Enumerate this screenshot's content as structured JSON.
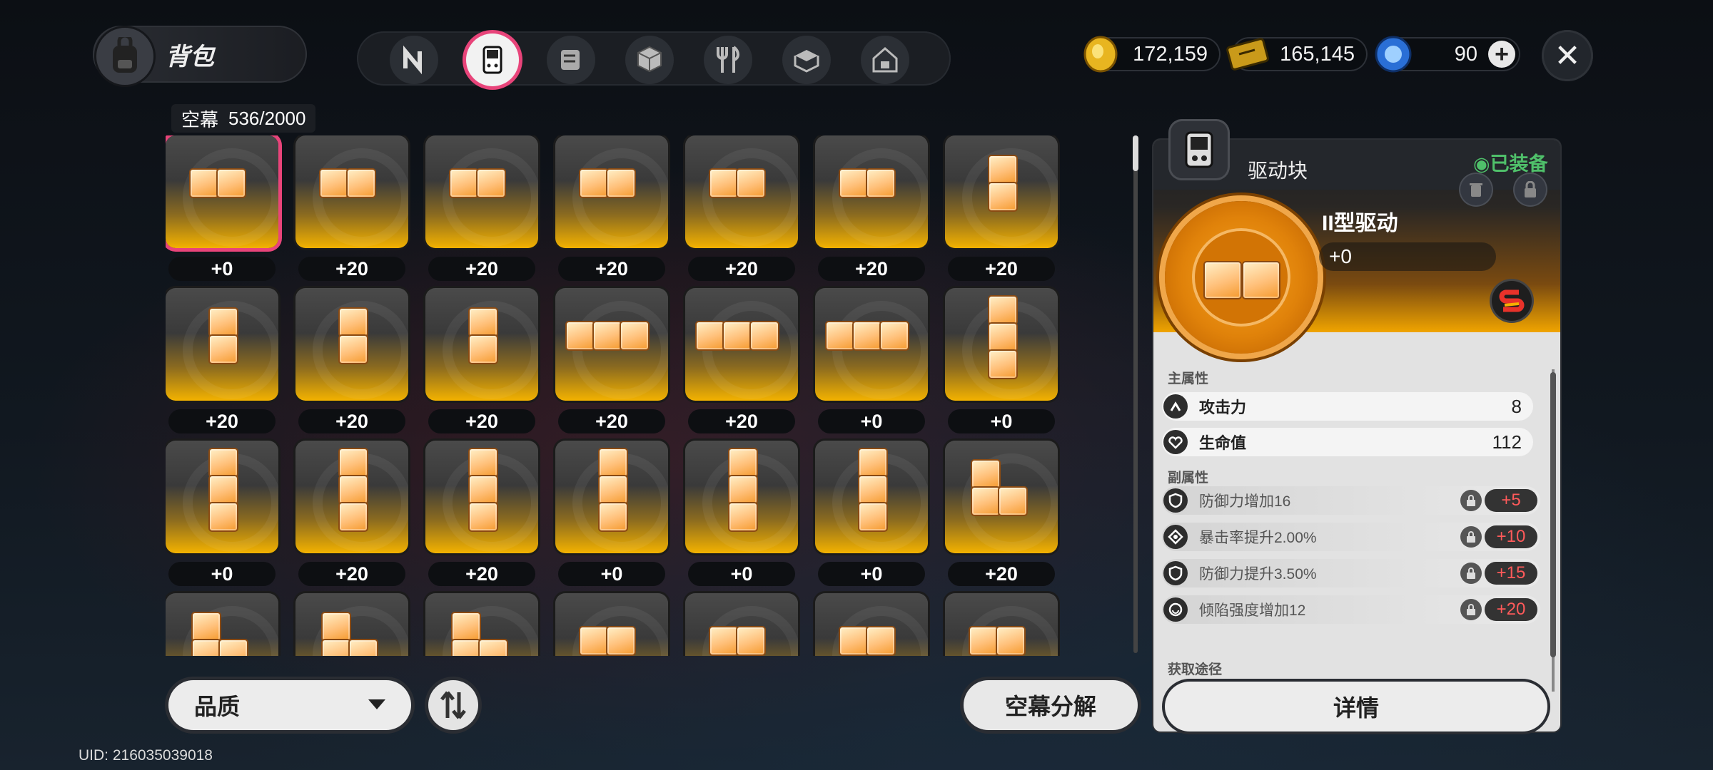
{
  "header": {
    "title": "背包",
    "categories": [
      "icon-n",
      "handheld",
      "scroll",
      "cube",
      "fork-knife",
      "box-open",
      "house-gift"
    ],
    "active_category": 1,
    "currencies": [
      {
        "name": "gold-coin",
        "value": "172,159"
      },
      {
        "name": "ticket",
        "value": "165,145"
      },
      {
        "name": "blue-gem",
        "value": "90"
      }
    ]
  },
  "inventory": {
    "label": "空幕",
    "count": "536/2000",
    "items": [
      {
        "shape": "h2",
        "level": "+0",
        "selected": true
      },
      {
        "shape": "h2",
        "level": "+20"
      },
      {
        "shape": "h2",
        "level": "+20"
      },
      {
        "shape": "h2",
        "level": "+20"
      },
      {
        "shape": "h2",
        "level": "+20"
      },
      {
        "shape": "h2",
        "level": "+20"
      },
      {
        "shape": "v2",
        "level": "+20"
      },
      {
        "shape": "v2",
        "level": "+20"
      },
      {
        "shape": "v2",
        "level": "+20"
      },
      {
        "shape": "v2",
        "level": "+20"
      },
      {
        "shape": "h3",
        "level": "+20"
      },
      {
        "shape": "h3",
        "level": "+20"
      },
      {
        "shape": "h3",
        "level": "+0"
      },
      {
        "shape": "v3",
        "level": "+0"
      },
      {
        "shape": "v3",
        "level": "+0"
      },
      {
        "shape": "v3",
        "level": "+20"
      },
      {
        "shape": "v3",
        "level": "+20"
      },
      {
        "shape": "v3",
        "level": "+0"
      },
      {
        "shape": "v3",
        "level": "+0"
      },
      {
        "shape": "v3",
        "level": "+0"
      },
      {
        "shape": "L",
        "level": "+20"
      },
      {
        "shape": "L",
        "level": ""
      },
      {
        "shape": "L",
        "level": ""
      },
      {
        "shape": "L",
        "level": ""
      },
      {
        "shape": "h2",
        "level": ""
      },
      {
        "shape": "h2",
        "level": ""
      },
      {
        "shape": "h2",
        "level": ""
      },
      {
        "shape": "h2",
        "level": ""
      }
    ]
  },
  "footer": {
    "sort_label": "品质",
    "decompose_label": "空幕分解",
    "uid": "UID: 216035039018"
  },
  "detail": {
    "type": "驱动块",
    "equipped": "已装备",
    "name": "II型驱动",
    "level": "+0",
    "main_title": "主属性",
    "main_stats": [
      {
        "icon": "attack-icon",
        "name": "攻击力",
        "value": "8"
      },
      {
        "icon": "heart-icon",
        "name": "生命值",
        "value": "112"
      }
    ],
    "sub_title": "副属性",
    "sub_stats": [
      {
        "icon": "shield-icon",
        "name": "防御力增加16",
        "value": "+5"
      },
      {
        "icon": "crit-icon",
        "name": "暴击率提升2.00%",
        "value": "+10"
      },
      {
        "icon": "shield-icon",
        "name": "防御力提升3.50%",
        "value": "+15"
      },
      {
        "icon": "smile-icon",
        "name": "倾陷强度增加12",
        "value": "+20"
      }
    ],
    "source_title": "获取途径",
    "detail_button": "详情"
  },
  "colors": {
    "accent": "#e8447a",
    "gold": "#f3b200",
    "equipped_green": "#4fc06a",
    "stat_red": "#ff5a5a"
  }
}
